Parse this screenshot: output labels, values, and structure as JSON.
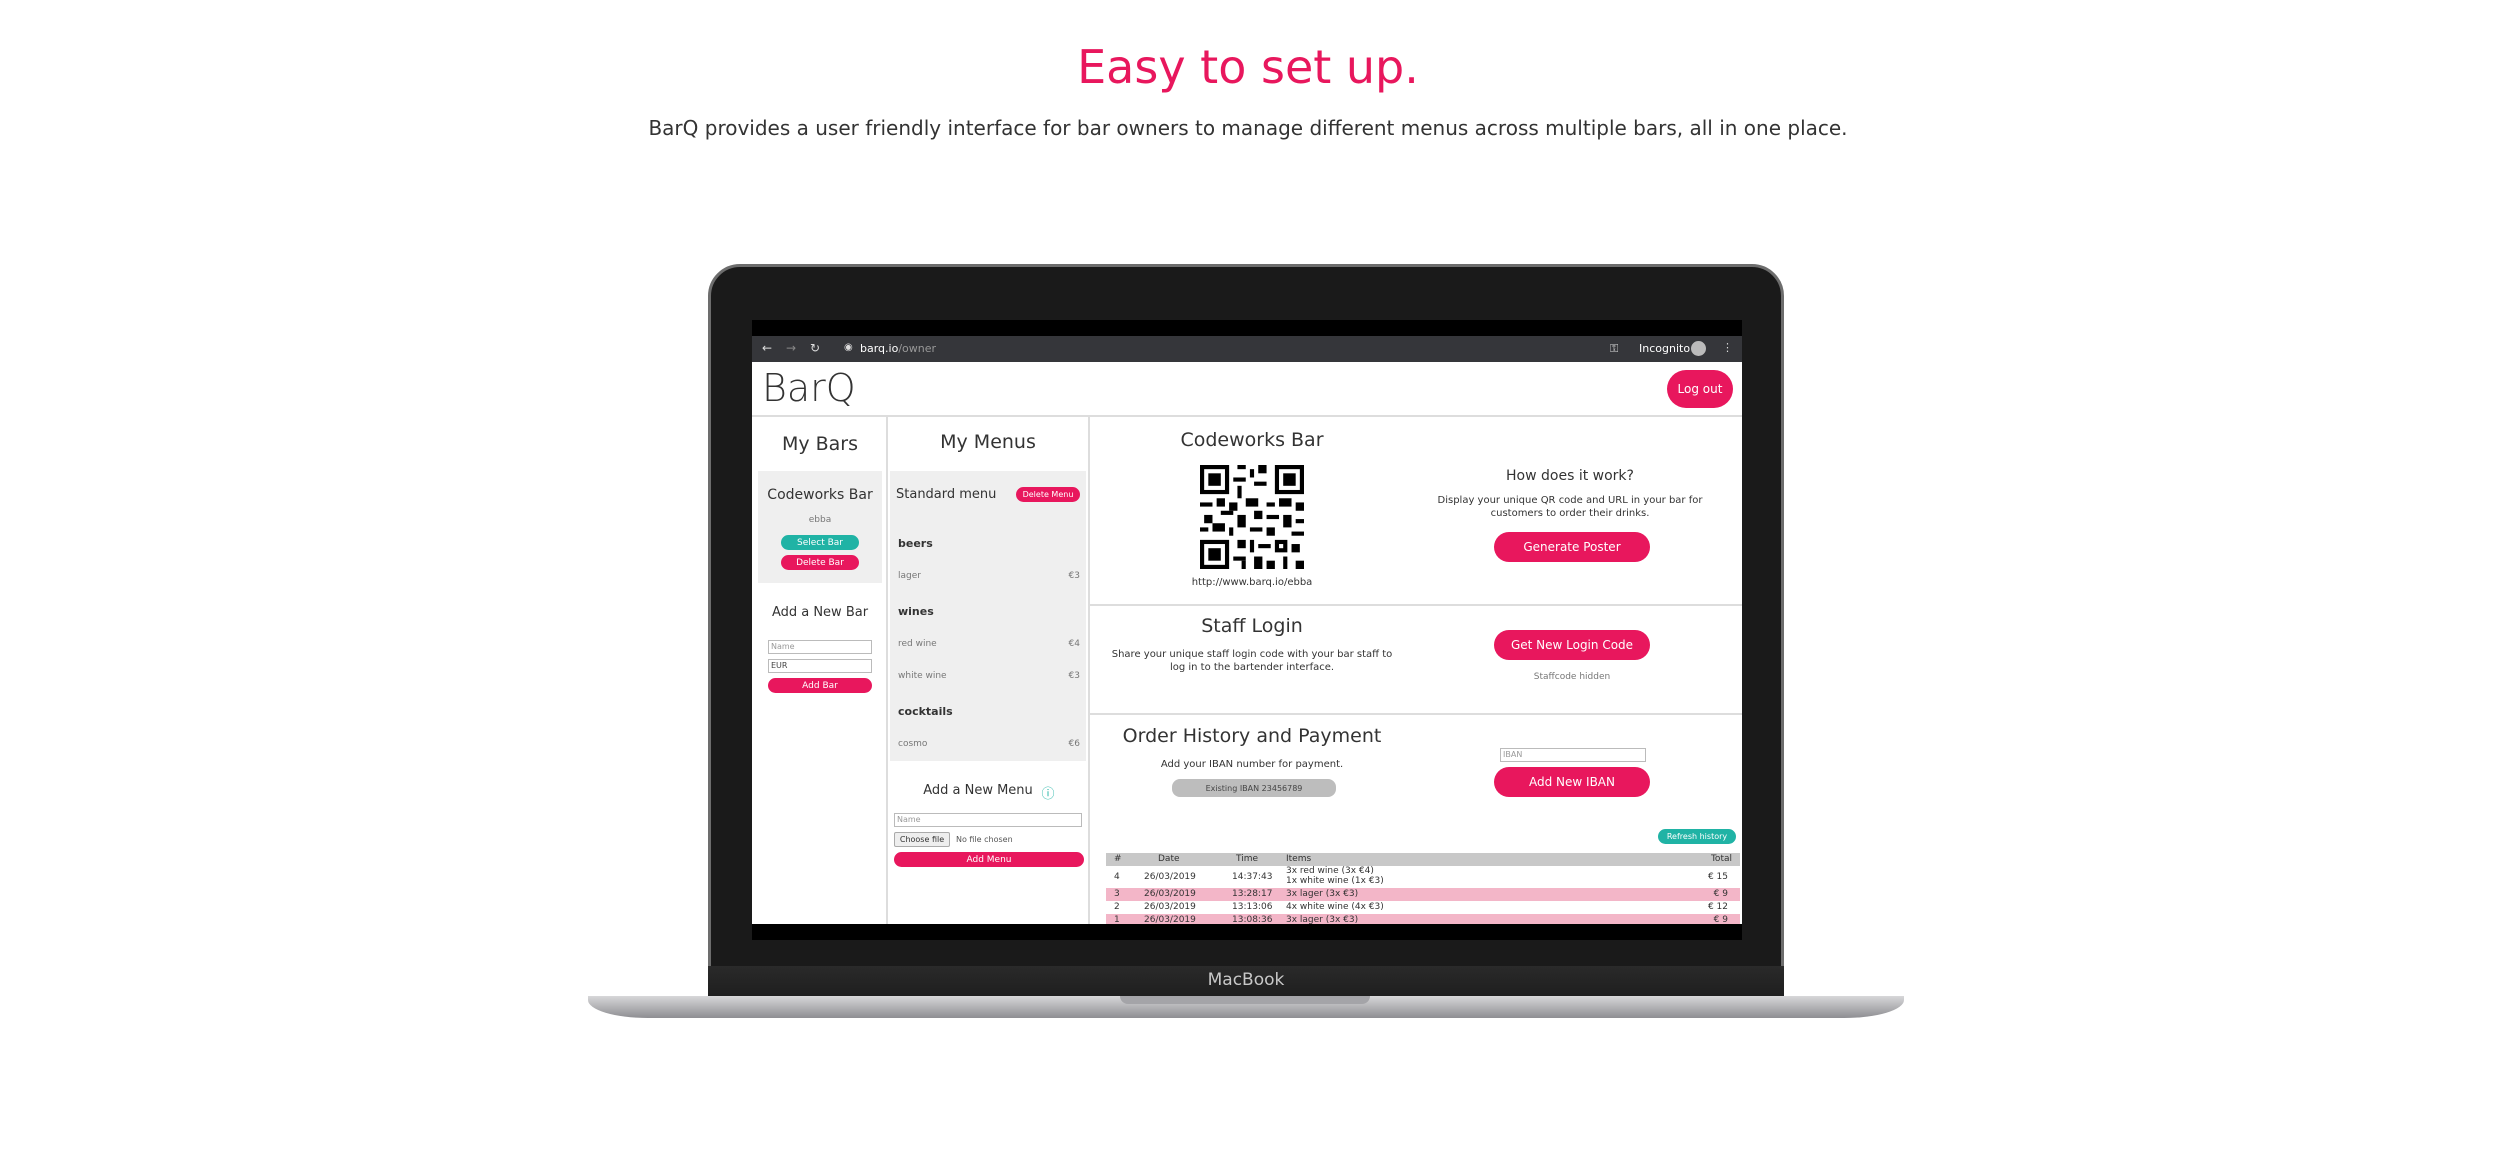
{
  "hero": {
    "title": "Easy to set up.",
    "subtitle": "BarQ provides a user friendly interface for bar owners to manage different menus across multiple bars, all in one place."
  },
  "laptop": {
    "label": "MacBook"
  },
  "browser": {
    "url_host": "barq.io",
    "url_path": "/owner",
    "incognito_label": "Incognito"
  },
  "app": {
    "brand": "BarQ",
    "logout_label": "Log out",
    "bars": {
      "heading": "My Bars",
      "card_name": "Codeworks Bar",
      "card_code": "ebba",
      "select_label": "Select Bar",
      "delete_label": "Delete Bar",
      "add_heading": "Add a New Bar",
      "name_placeholder": "Name",
      "currency_value": "EUR",
      "add_label": "Add Bar"
    },
    "menus": {
      "heading": "My Menus",
      "menu_name": "Standard menu",
      "delete_label": "Delete Menu",
      "categories": [
        {
          "name": "beers",
          "items": [
            {
              "name": "lager",
              "price": "€3"
            }
          ]
        },
        {
          "name": "wines",
          "items": [
            {
              "name": "red wine",
              "price": "€4"
            },
            {
              "name": "white wine",
              "price": "€3"
            }
          ]
        },
        {
          "name": "cocktails",
          "items": [
            {
              "name": "cosmo",
              "price": "€6"
            }
          ]
        }
      ],
      "add_heading": "Add a New Menu",
      "info_icon": "ⓘ",
      "name_placeholder": "Name",
      "choose_file_label": "Choose file",
      "no_file_label": "No file chosen",
      "add_label": "Add Menu"
    },
    "bar_panel": {
      "title": "Codeworks Bar",
      "url": "http://www.barq.io/ebba",
      "how_title": "How does it work?",
      "how_text_1": "Display your unique QR code and URL in your bar for",
      "how_text_2": "customers to order their drinks.",
      "poster_label": "Generate Poster"
    },
    "staff": {
      "title": "Staff Login",
      "text_1": "Share your unique staff login code with your bar staff to",
      "text_2": "log in to the bartender interface.",
      "button_label": "Get New Login Code",
      "status": "Staffcode hidden"
    },
    "orders": {
      "title": "Order History and Payment",
      "iban_text": "Add your IBAN number for payment.",
      "existing_iban": "Existing IBAN 23456789",
      "iban_placeholder": "IBAN",
      "add_iban_label": "Add New IBAN",
      "refresh_label": "Refresh history",
      "columns": [
        "#",
        "Date",
        "Time",
        "Items",
        "Total"
      ],
      "rows": [
        {
          "num": "4",
          "date": "26/03/2019",
          "time": "14:37:43",
          "items": "3x red wine (3x €4)",
          "items2": "1x white wine (1x €3)",
          "total": "€ 15"
        },
        {
          "num": "3",
          "date": "26/03/2019",
          "time": "13:28:17",
          "items": "3x lager (3x €3)",
          "items2": "",
          "total": "€ 9"
        },
        {
          "num": "2",
          "date": "26/03/2019",
          "time": "13:13:06",
          "items": "4x white wine (4x €3)",
          "items2": "",
          "total": "€ 12"
        },
        {
          "num": "1",
          "date": "26/03/2019",
          "time": "13:08:36",
          "items": "3x lager (3x €3)",
          "items2": "",
          "total": "€ 9"
        }
      ]
    }
  },
  "colors": {
    "accent": "#e8175d",
    "teal": "#20b3a5"
  }
}
